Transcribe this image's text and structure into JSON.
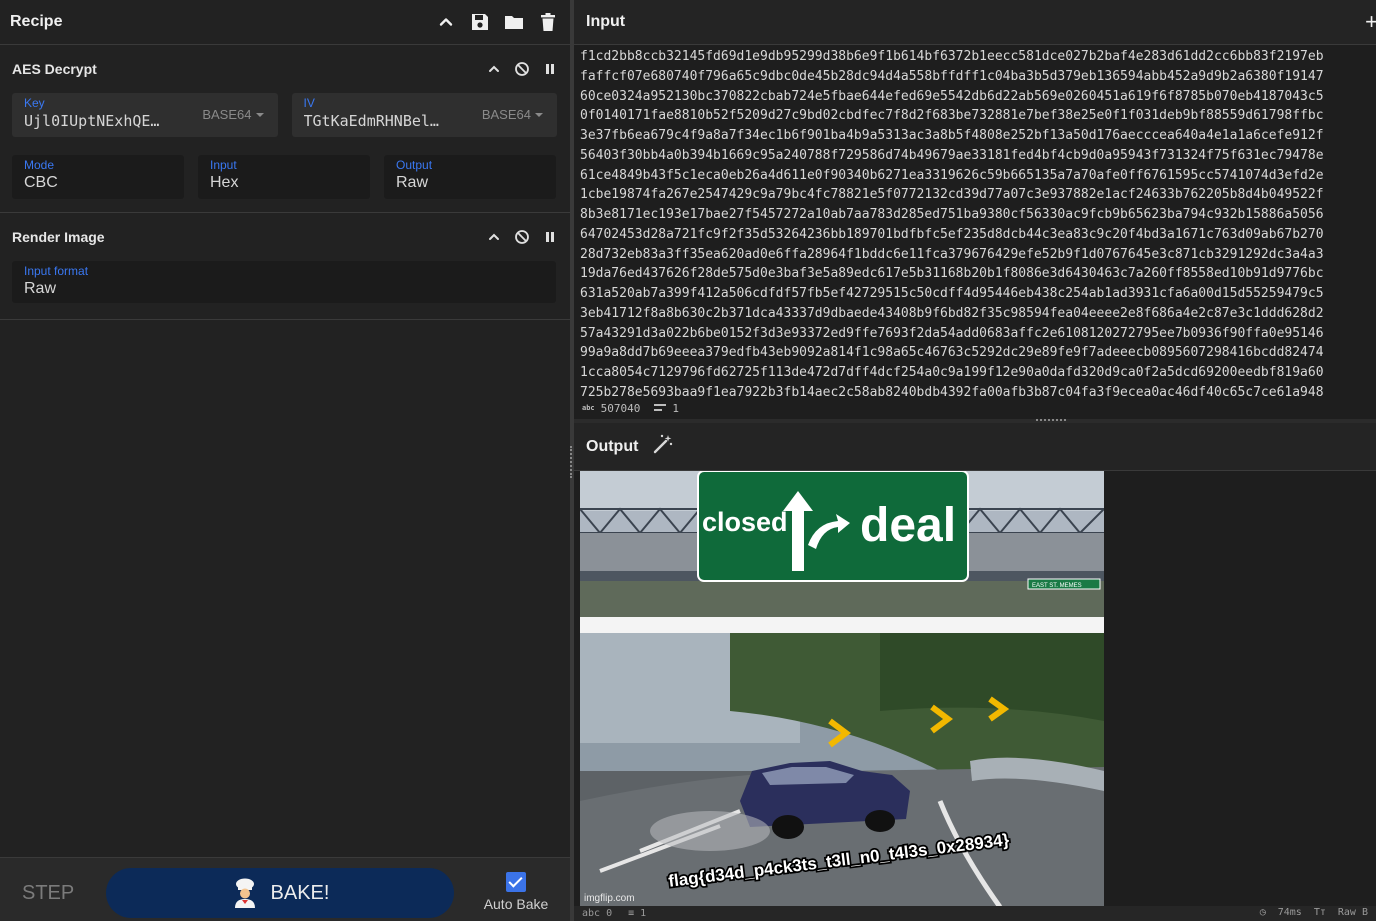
{
  "recipe": {
    "title": "Recipe"
  },
  "operations": {
    "aes": {
      "title": "AES Decrypt",
      "key": {
        "label": "Key",
        "value": "Ujl0IUptNExhQE…",
        "encoding": "BASE64"
      },
      "iv": {
        "label": "IV",
        "value": "TGtKaEdmRHNBel…",
        "encoding": "BASE64"
      },
      "mode": {
        "label": "Mode",
        "value": "CBC"
      },
      "input": {
        "label": "Input",
        "value": "Hex"
      },
      "output": {
        "label": "Output",
        "value": "Raw"
      }
    },
    "render": {
      "title": "Render Image",
      "format": {
        "label": "Input format",
        "value": "Raw"
      }
    }
  },
  "controls": {
    "step": "STEP",
    "bake": "BAKE!",
    "auto_bake": "Auto Bake",
    "auto_bake_checked": true
  },
  "input_panel": {
    "title": "Input",
    "lines": [
      "f1cd2bb8ccb32145fd69d1e9db95299d38b6e9f1b614bf6372b1eecc581dce027b2baf4e283d61dd2cc6bb83f2197eb",
      "faffcf07e680740f796a65c9dbc0de45b28dc94d4a558bffdff1c04ba3b5d379eb136594abb452a9d9b2a6380f19147",
      "60ce0324a952130bc370822cbab724e5fbae644efed69e5542db6d22ab569e0260451a619f6f8785b070eb4187043c5",
      "0f0140171fae8810b52f5209d27c9bd02cbdfec7f8d2f683be732881e7bef38e25e0f1f031deb9bf88559d61798ffbc",
      "3e37fb6ea679c4f9a8a7f34ec1b6f901ba4b9a5313ac3a8b5f4808e252bf13a50d176aecccea640a4e1a1a6cefe912f",
      "56403f30bb4a0b394b1669c95a240788f729586d74b49679ae33181fed4bf4cb9d0a95943f731324f75f631ec79478e",
      "61ce4849b43f5c1eca0eb26a4d611e0f90340b6271ea3319626c59b665135a7a70afe0ff6761595cc5741074d3efd2e",
      "1cbe19874fa267e2547429c9a79bc4fc78821e5f0772132cd39d77a07c3e937882e1acf24633b762205b8d4b049522f",
      "8b3e8171ec193e17bae27f5457272a10ab7aa783d285ed751ba9380cf56330ac9fcb9b65623ba794c932b15886a5056",
      "64702453d28a721fc9f2f35d53264236bb189701bdfbfc5ef235d8dcb44c3ea83c9c20f4bd3a1671c763d09ab67b270",
      "28d732eb83a3ff35ea620ad0e6ffa28964f1bddc6e11fca379676429efe52b9f1d0767645e3c871cb3291292dc3a4a3",
      "19da76ed437626f28de575d0e3baf3e5a89edc617e5b31168b20b1f8086e3d6430463c7a260ff8558ed10b91d9776bc",
      "631a520ab7a399f412a506cdfdf57fb5ef42729515c50cdff4d95446eb438c254ab1ad3931cfa6a00d15d55259479c5",
      "3eb41712f8a8b630c2b371dca43337d9dbaede43408b9f6bd82f35c98594fea04eeee2e8f686a4e2c87e3c1ddd628d2",
      "57a43291d3a022b6be0152f3d3e93372ed9ffe7693f2da54add0683affc2e6108120272795ee7b0936f90ffa0e95146",
      "99a9a8dd7b69eeea379edfb43eb9092a814f1c98a65c46763c5292dc29e89fe9f7adeeecb0895607298416bcdd82474",
      "1cca8054c7129796fd62725f113de472d7dff4dcf254a0c9a199f12e90a0dafd320d9ca0f2a5dcd69200eedbf819a60",
      "725b278e5693baa9f1ea7922b3fb14aec2c58ab8240bdb4392fa00afb3b87c04fa3f9ecea0ac46df40c65c7ce61a948"
    ],
    "length_tag": "abc",
    "length": "507040",
    "line_count": "1"
  },
  "output_panel": {
    "title": "Output",
    "length_tag": "abc",
    "length": "0",
    "line_count": "1",
    "time": "74ms",
    "encoding": "Raw B"
  },
  "meme": {
    "sign_left": "closed",
    "sign_right": "deal",
    "flag": "flag{d34d_p4ck3ts_t3ll_n0_t4l3s_0x28934}",
    "watermark": "imgflip.com",
    "small_sign": "EAST ST. MEMES"
  },
  "colors": {
    "accent": "#3a78f2",
    "bake_button": "#0c2a58",
    "sign_green": "#0f6a3a"
  }
}
